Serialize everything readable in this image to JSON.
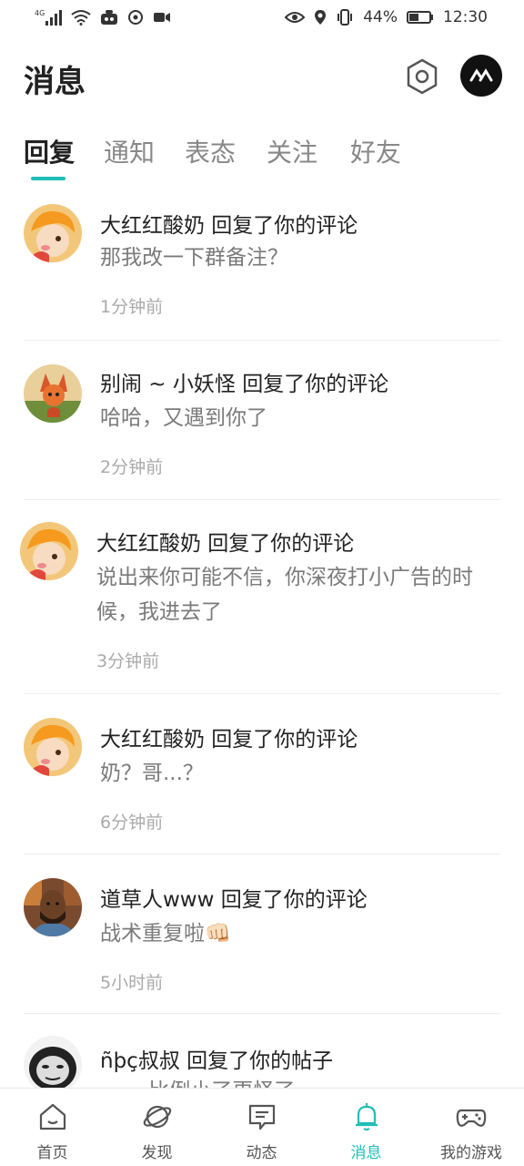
{
  "status_bar": {
    "network": "4G",
    "battery": "44%",
    "time": "12:30"
  },
  "header": {
    "title": "消息"
  },
  "tabs": [
    {
      "label": "回复",
      "active": true
    },
    {
      "label": "通知",
      "active": false
    },
    {
      "label": "表态",
      "active": false
    },
    {
      "label": "关注",
      "active": false
    },
    {
      "label": "好友",
      "active": false
    }
  ],
  "messages": [
    {
      "title": "大红红酸奶 回复了你的评论",
      "body": "那我改一下群备注？",
      "time": "1分钟前",
      "avatar": "cartoon-kid"
    },
    {
      "title": "别闹 ~ 小妖怪 回复了你的评论",
      "body": "哈哈，又遇到你了",
      "time": "2分钟前",
      "avatar": "fox-character"
    },
    {
      "title": "大红红酸奶 回复了你的评论",
      "body": "说出来你可能不信，你深夜打小广告的时候，我进去了",
      "time": "3分钟前",
      "avatar": "cartoon-kid"
    },
    {
      "title": "大红红酸奶 回复了你的评论",
      "body": "奶？哥...？",
      "time": "6分钟前",
      "avatar": "cartoon-kid"
    },
    {
      "title": "道草人www 回复了你的评论",
      "body": "战术重复啦👊🏻",
      "time": "5小时前",
      "avatar": "man-photo"
    },
    {
      "title": "ñþç叔叔 回复了你的帖子",
      "body": "…… 比例小了更怪了",
      "time": "",
      "avatar": "meme-face"
    }
  ],
  "bottom_nav": [
    {
      "label": "首页",
      "icon": "home-icon",
      "active": false
    },
    {
      "label": "发现",
      "icon": "discover-icon",
      "active": false
    },
    {
      "label": "动态",
      "icon": "feed-icon",
      "active": false
    },
    {
      "label": "消息",
      "icon": "bell-icon",
      "active": true
    },
    {
      "label": "我的游戏",
      "icon": "gamepad-icon",
      "active": false
    }
  ],
  "colors": {
    "accent": "#1fbfb8",
    "text_primary": "#222222",
    "text_secondary": "#7a7a7a",
    "text_muted": "#aaaaaa"
  }
}
